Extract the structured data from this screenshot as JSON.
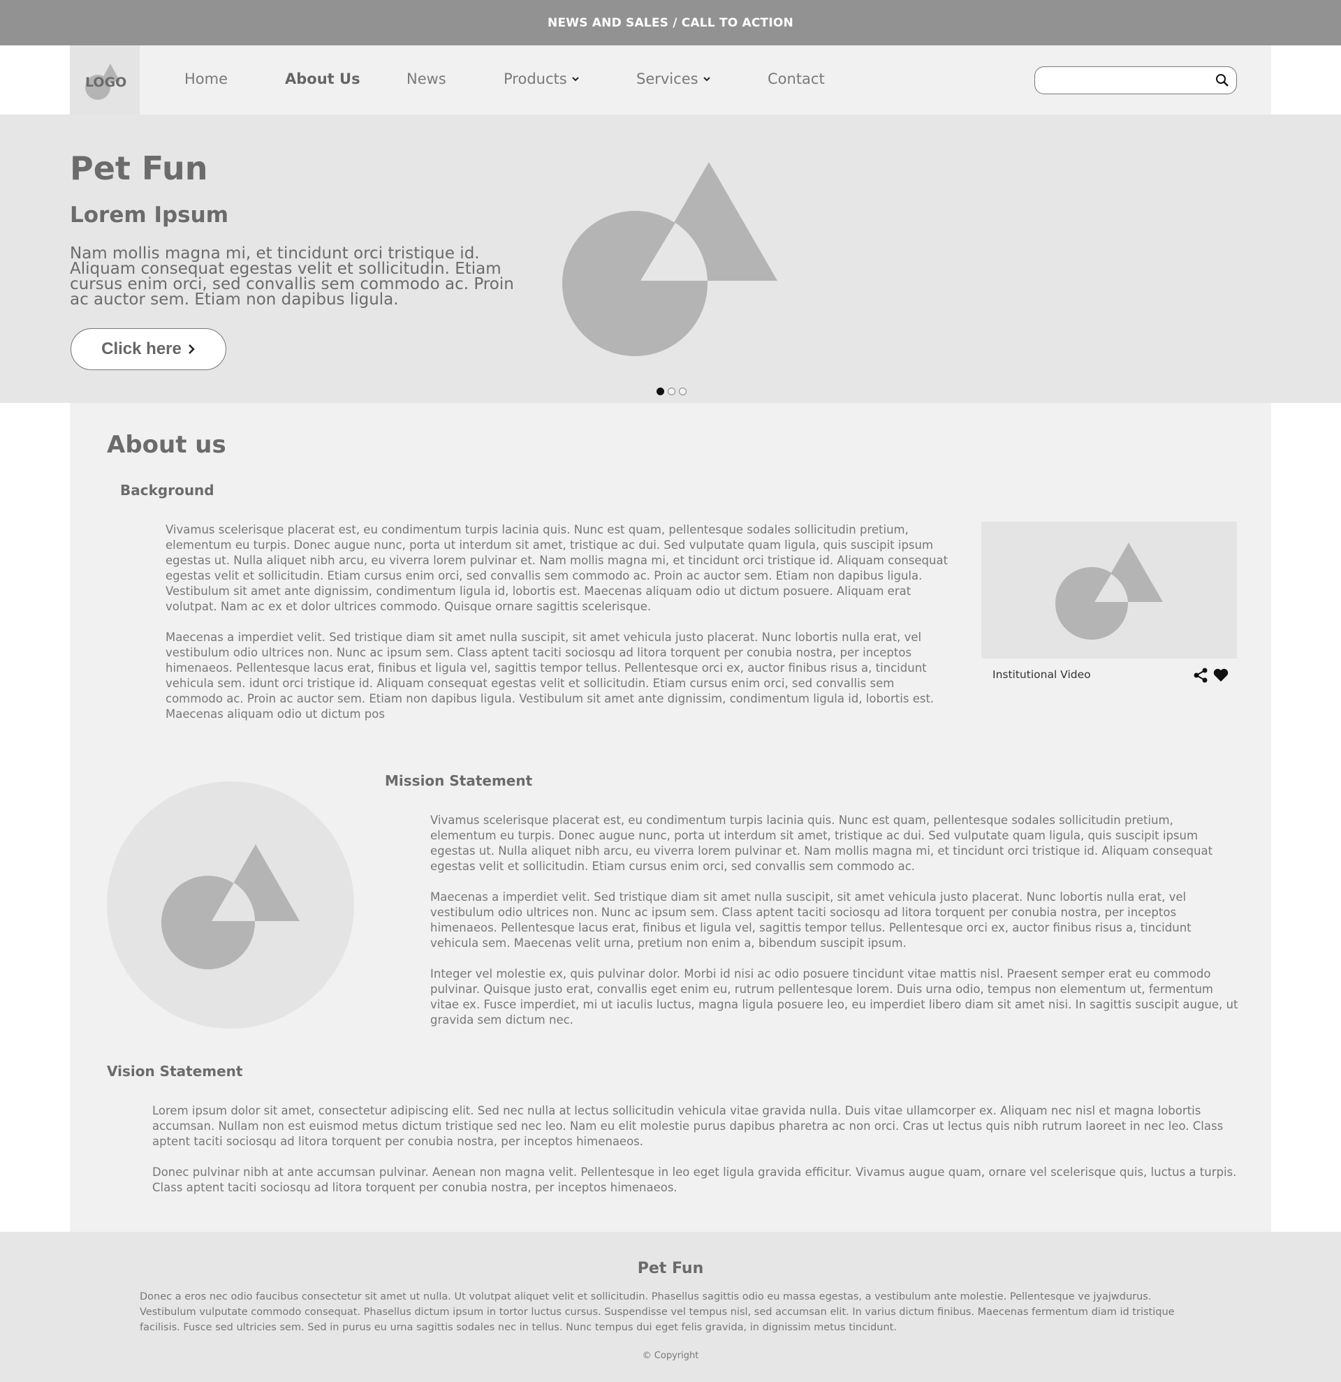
{
  "topbar": {
    "text": "NEWS AND SALES / CALL TO ACTION"
  },
  "nav": {
    "logo": "LOGO",
    "items": [
      {
        "label": "Home"
      },
      {
        "label": "About Us"
      },
      {
        "label": "News"
      },
      {
        "label": "Products"
      },
      {
        "label": "Services"
      },
      {
        "label": "Contact"
      }
    ],
    "active": "About Us",
    "search_placeholder": ""
  },
  "hero": {
    "title": "Pet Fun",
    "subtitle": "Lorem Ipsum",
    "text": "Nam mollis magna mi, et tincidunt orci tristique id. Aliquam consequat egestas velit et sollicitudin. Etiam cursus enim orci, sed convallis sem commodo ac. Proin ac auctor sem. Etiam non dapibus ligula.",
    "button": "Click here",
    "slides": 3,
    "active_slide": 1
  },
  "about": {
    "title": "About us",
    "background": {
      "heading": "Background",
      "p1": "Vivamus scelerisque placerat est, eu condimentum turpis lacinia quis. Nunc est quam, pellentesque sodales sollicitudin pretium, elementum eu turpis. Donec augue nunc, porta ut interdum sit amet, tristique ac dui. Sed vulputate quam ligula, quis suscipit ipsum egestas ut. Nulla aliquet nibh arcu, eu viverra lorem pulvinar et. Nam mollis magna mi, et tincidunt orci tristique id. Aliquam consequat egestas velit et sollicitudin. Etiam cursus enim orci, sed convallis sem commodo ac. Proin ac auctor sem. Etiam non dapibus ligula. Vestibulum sit amet ante dignissim, condimentum ligula id, lobortis est. Maecenas aliquam odio ut dictum posuere. Aliquam erat volutpat. Nam ac ex et dolor ultrices commodo. Quisque ornare sagittis scelerisque.",
      "p2": "Maecenas a imperdiet velit. Sed tristique diam sit amet nulla suscipit, sit amet vehicula justo placerat. Nunc lobortis nulla erat, vel vestibulum odio ultrices non. Nunc ac ipsum sem. Class aptent taciti sociosqu ad litora torquent per conubia nostra, per inceptos himenaeos. Pellentesque lacus erat, finibus et ligula vel, sagittis tempor tellus. Pellentesque orci ex, auctor finibus risus a, tincidunt vehicula sem. idunt orci tristique id. Aliquam consequat egestas velit et sollicitudin. Etiam cursus enim orci, sed convallis sem commodo ac. Proin ac auctor sem. Etiam non dapibus ligula. Vestibulum sit amet ante dignissim, condimentum ligula id, lobortis est. Maecenas aliquam odio ut dictum pos",
      "video_label": "Institutional Video"
    },
    "mission": {
      "heading": "Mission Statement",
      "p1": "Vivamus scelerisque placerat est, eu condimentum turpis lacinia quis. Nunc est quam, pellentesque sodales sollicitudin pretium, elementum eu turpis. Donec augue nunc, porta ut interdum sit amet, tristique ac dui. Sed vulputate quam ligula, quis suscipit ipsum egestas ut. Nulla aliquet nibh arcu, eu viverra lorem pulvinar et. Nam mollis magna mi, et tincidunt orci tristique id. Aliquam consequat egestas velit et sollicitudin. Etiam cursus enim orci, sed convallis sem commodo ac.",
      "p2": "Maecenas a imperdiet velit. Sed tristique diam sit amet nulla suscipit, sit amet vehicula justo placerat. Nunc lobortis nulla erat, vel vestibulum odio ultrices non. Nunc ac ipsum sem. Class aptent taciti sociosqu ad litora torquent per conubia nostra, per inceptos himenaeos. Pellentesque lacus erat, finibus et ligula vel, sagittis tempor tellus. Pellentesque orci ex, auctor finibus risus a, tincidunt vehicula sem. Maecenas velit urna, pretium non enim a, bibendum suscipit ipsum.",
      "p3": "Integer vel molestie ex, quis pulvinar dolor. Morbi id nisi ac odio posuere tincidunt vitae mattis nisl. Praesent semper erat eu commodo pulvinar. Quisque justo erat, convallis eget enim eu, rutrum pellentesque lorem. Duis urna odio, tempus non elementum ut, fermentum vitae ex. Fusce imperdiet, mi ut iaculis luctus, magna ligula posuere leo, eu imperdiet libero diam sit amet nisi. In sagittis suscipit augue, ut gravida sem dictum nec."
    },
    "vision": {
      "heading": "Vision Statement",
      "p1": "Lorem ipsum dolor sit amet, consectetur adipiscing elit. Sed nec nulla at lectus sollicitudin vehicula vitae gravida nulla. Duis vitae ullamcorper ex. Aliquam nec nisl et magna lobortis accumsan. Nullam non est euismod metus dictum tristique sed nec leo. Nam eu elit molestie purus dapibus pharetra ac non orci. Cras ut lectus quis nibh rutrum laoreet in nec leo. Class aptent taciti sociosqu ad litora torquent per conubia nostra, per inceptos himenaeos.",
      "p2": "Donec pulvinar nibh at ante accumsan pulvinar. Aenean non magna velit. Pellentesque in leo eget ligula gravida efficitur. Vivamus augue quam, ornare vel scelerisque quis, luctus a turpis. Class aptent taciti sociosqu ad litora torquent per conubia nostra, per inceptos himenaeos."
    }
  },
  "footer": {
    "title": "Pet Fun",
    "text": "Donec a eros nec odio faucibus consectetur sit amet ut nulla. Ut volutpat aliquet velit et sollicitudin. Phasellus sagittis odio eu massa egestas, a vestibulum ante molestie. Pellentesque ve jyajwdurus. Vestibulum vulputate commodo consequat. Phasellus dictum ipsum in tortor luctus cursus. Suspendisse vel tempus nisl, sed accumsan elit. In varius dictum finibus. Maecenas fermentum diam id tristique facilisis. Fusce sed ultricies sem. Sed in purus eu urna sagittis sodales nec in tellus. Nunc tempus dui eget felis gravida, in dignissim metus tincidunt.",
    "copyright": "© Copyright"
  },
  "colors": {
    "topbar": "#929292",
    "nav_bg": "#f1f1f1",
    "hero_bg": "#e6e6e6",
    "placeholder_shape": "#b4b4b4",
    "text": "#6b6b6b"
  },
  "icons": [
    "logo-icon",
    "chevron-down-icon",
    "search-icon",
    "chevron-right-icon",
    "share-icon",
    "heart-icon",
    "image-placeholder-icon"
  ]
}
